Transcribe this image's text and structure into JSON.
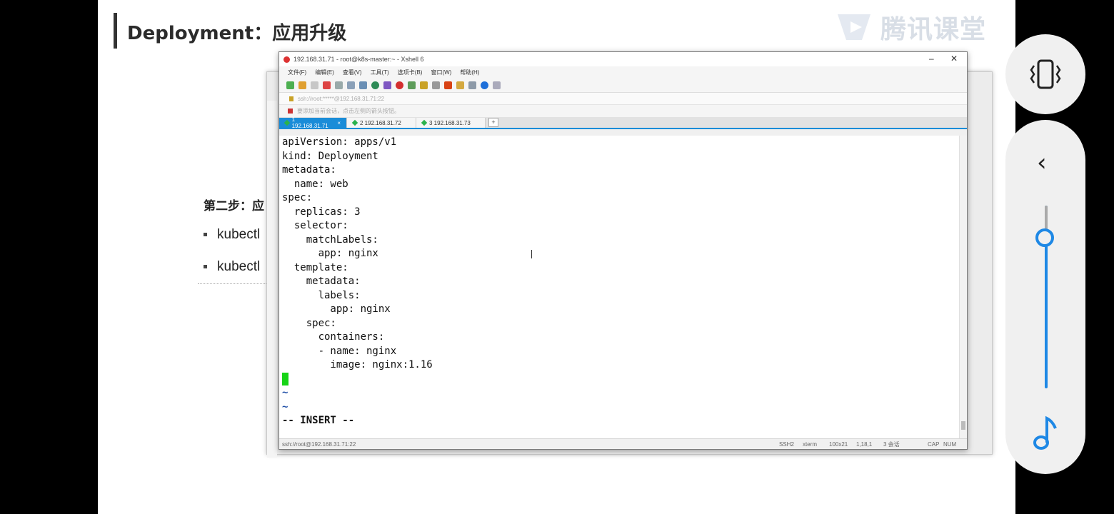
{
  "slide": {
    "title": "Deployment：应用升级",
    "brand": "腾讯课堂",
    "step_label": "第二步：应",
    "bullets": [
      "kubectl",
      "kubectl"
    ]
  },
  "xshell": {
    "window_title": "192.168.31.71 - root@k8s-master:~ - Xshell 6",
    "menu": [
      "文件(F)",
      "编辑(E)",
      "查看(V)",
      "工具(T)",
      "选项卡(B)",
      "窗口(W)",
      "帮助(H)"
    ],
    "address": "ssh://root:*****@192.168.31.71:22",
    "hint": "要添加当前会话，点击左侧的箭头按钮。",
    "tabs": [
      {
        "label": "1 192.168.31.71",
        "active": true
      },
      {
        "label": "2 192.168.31.72",
        "active": false
      },
      {
        "label": "3 192.168.31.73",
        "active": false
      }
    ],
    "terminal_lines": [
      "apiVersion: apps/v1",
      "kind: Deployment",
      "metadata:",
      "  name: web",
      "spec:",
      "  replicas: 3",
      "  selector:",
      "    matchLabels:",
      "      app: nginx",
      "  template:",
      "    metadata:",
      "      labels:",
      "        app: nginx",
      "    spec:",
      "      containers:",
      "      - name: nginx",
      "        image: nginx:1.16"
    ],
    "tilde_lines": [
      "~",
      "~"
    ],
    "mode_line": "-- INSERT --",
    "status": {
      "connection": "ssh://root@192.168.31.71:22",
      "protocol": "SSH2",
      "term": "xterm",
      "size": "100x21",
      "pos": "1,18,1",
      "sessions": "3 会话",
      "caps": "CAP",
      "num": "NUM"
    }
  },
  "controls": {
    "vibrate_icon": "vibrate-icon",
    "back_icon": "chevron-left-icon",
    "music_icon": "music-note-icon",
    "volume_level": 0.85,
    "accent_color": "#1e88e5"
  }
}
